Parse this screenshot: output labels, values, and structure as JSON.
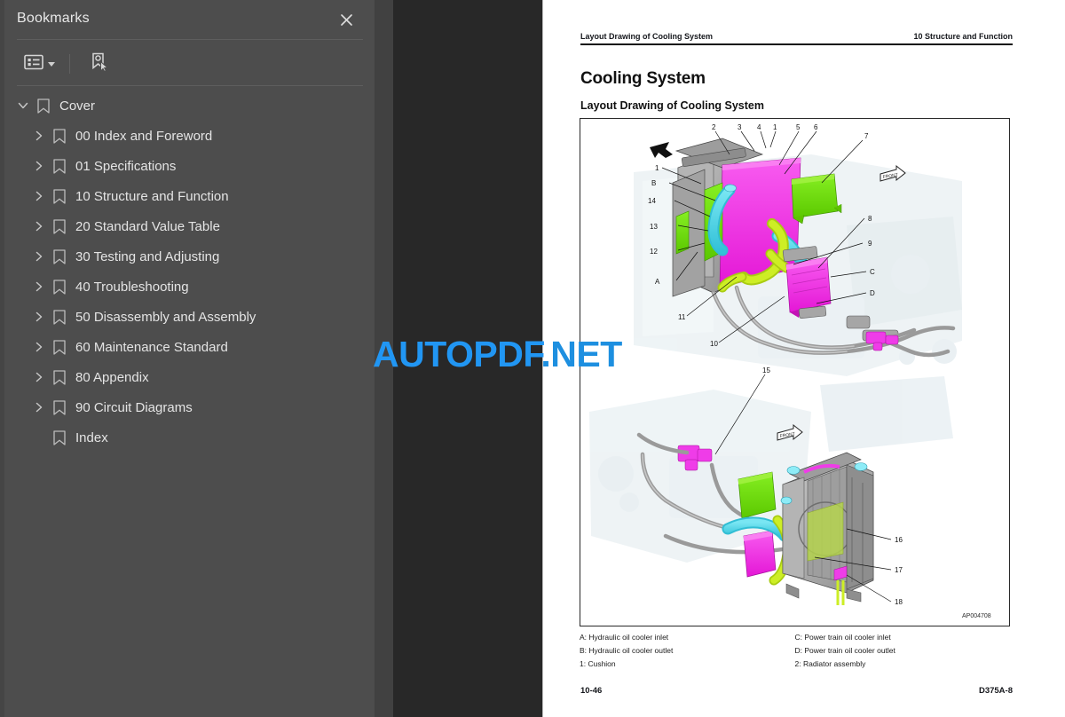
{
  "sidebar": {
    "title": "Bookmarks",
    "close_icon": "close-icon",
    "toolbar": {
      "options_icon": "bookmark-options-icon",
      "options_label": "Bookmark Options",
      "new_bookmark_icon": "new-bookmark-icon",
      "new_bookmark_label": "New Bookmark"
    },
    "bookmarks": [
      {
        "label": "Cover",
        "level": 0,
        "expanded": true,
        "has_children": true
      },
      {
        "label": "00 Index and Foreword",
        "level": 1,
        "expanded": false,
        "has_children": true
      },
      {
        "label": "01 Specifications",
        "level": 1,
        "expanded": false,
        "has_children": true
      },
      {
        "label": "10 Structure and Function",
        "level": 1,
        "expanded": false,
        "has_children": true
      },
      {
        "label": "20 Standard Value Table",
        "level": 1,
        "expanded": false,
        "has_children": true
      },
      {
        "label": "30 Testing and Adjusting",
        "level": 1,
        "expanded": false,
        "has_children": true
      },
      {
        "label": "40 Troubleshooting",
        "level": 1,
        "expanded": false,
        "has_children": true
      },
      {
        "label": "50 Disassembly and Assembly",
        "level": 1,
        "expanded": false,
        "has_children": true
      },
      {
        "label": "60 Maintenance Standard",
        "level": 1,
        "expanded": false,
        "has_children": true
      },
      {
        "label": "80 Appendix",
        "level": 1,
        "expanded": false,
        "has_children": true
      },
      {
        "label": "90 Circuit Diagrams",
        "level": 1,
        "expanded": false,
        "has_children": true
      },
      {
        "label": "Index",
        "level": 1,
        "expanded": false,
        "has_children": false
      }
    ]
  },
  "document": {
    "header_left": "Layout Drawing of Cooling System",
    "header_right": "10 Structure and Function",
    "title": "Cooling System",
    "subtitle": "Layout Drawing of Cooling System",
    "figure_id": "AP004708",
    "front_marker": "FRONT",
    "callouts_top": [
      "1",
      "2",
      "3",
      "4",
      "5",
      "6",
      "7",
      "8",
      "9",
      "10",
      "11",
      "12",
      "13",
      "14",
      "A",
      "B",
      "C",
      "D"
    ],
    "callouts_bottom": [
      "15",
      "16",
      "17",
      "18"
    ],
    "legend_left": [
      "A: Hydraulic oil cooler inlet",
      "B: Hydraulic oil cooler outlet",
      "1: Cushion"
    ],
    "legend_right": [
      "C: Power train oil cooler inlet",
      "D: Power train oil cooler outlet",
      "2: Radiator assembly"
    ],
    "footer_left": "10-46",
    "footer_right": "D375A-8"
  },
  "watermark": {
    "text_main": "AUTOPDF",
    "text_suffix": ".NET",
    "color": "#2196f3"
  },
  "colors": {
    "sidebar_bg": "#4d4d4d",
    "viewer_bg": "#282828",
    "page_bg": "#ffffff",
    "text": "#e4e4e4",
    "accent_magenta": "#ef3ce8",
    "accent_green": "#6ede10",
    "accent_cyan": "#4dd5e8",
    "accent_yellowgreen": "#c9e820"
  }
}
